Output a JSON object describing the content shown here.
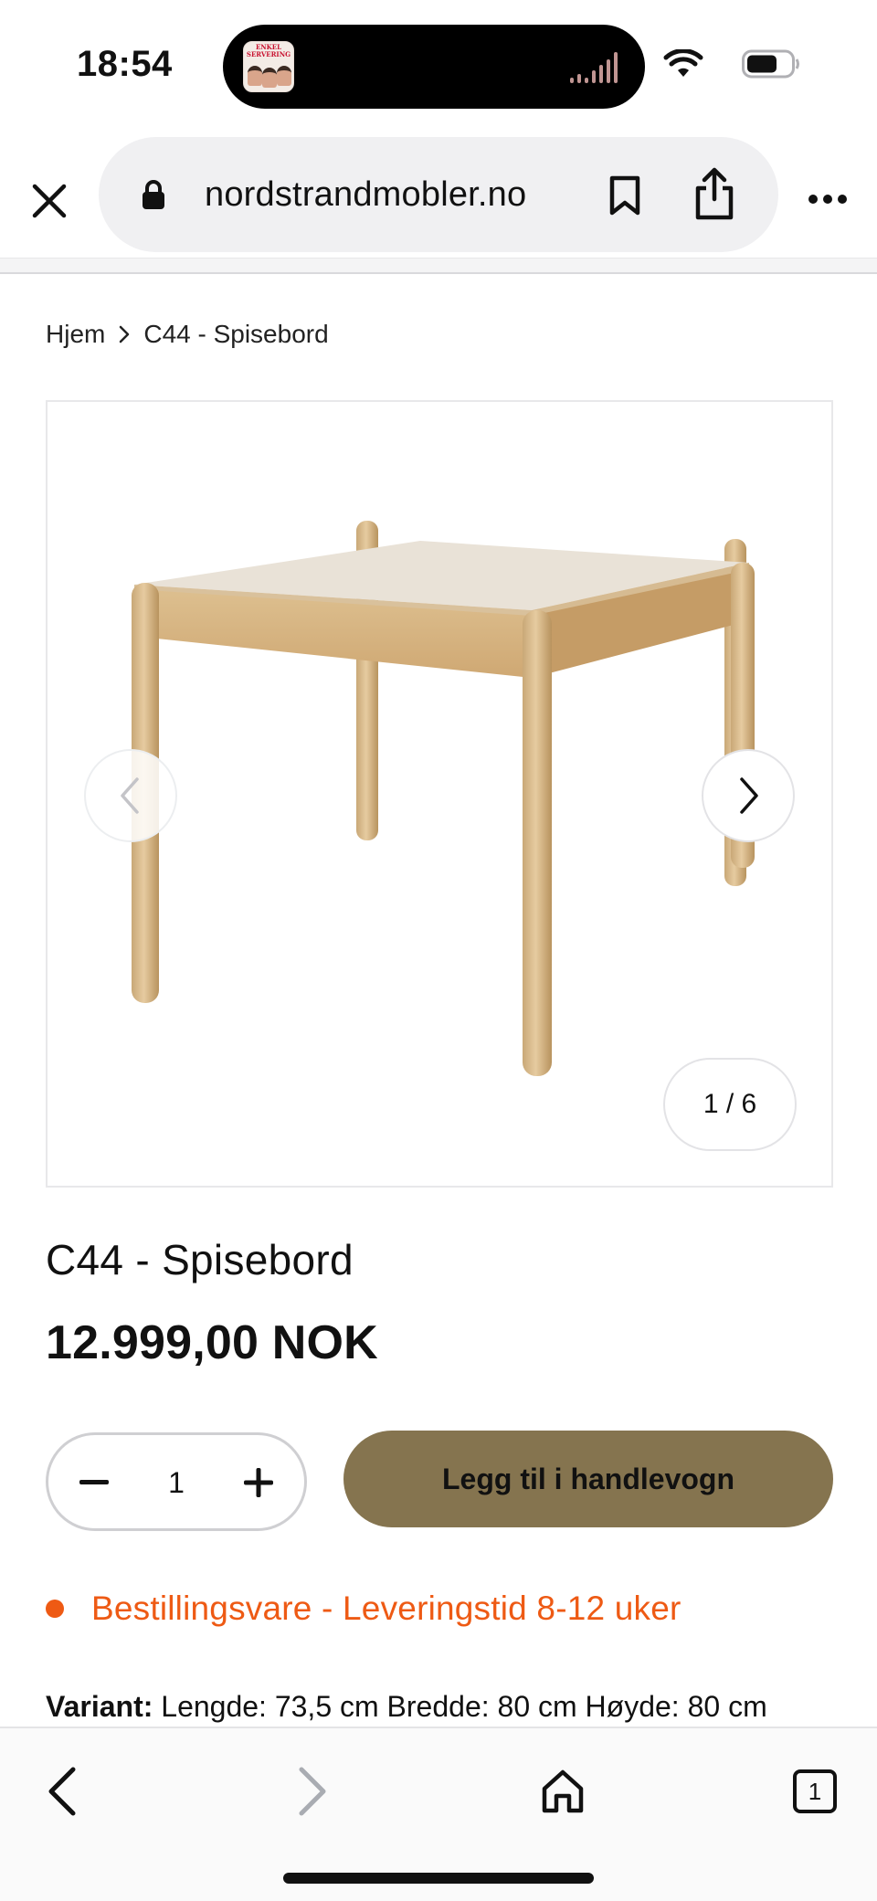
{
  "status_bar": {
    "time": "18:54",
    "now_playing_art_caption": "ENKEL SERVERING"
  },
  "browser": {
    "url": "nordstrandmobler.no",
    "icons": {
      "close": "close-icon",
      "lock": "lock-icon",
      "bookmark": "bookmark-icon",
      "share": "share-icon",
      "more": "more-icon"
    }
  },
  "breadcrumb": {
    "home": "Hjem",
    "current": "C44 - Spisebord"
  },
  "gallery": {
    "counter": "1 / 6",
    "current_index": 1,
    "total": 6
  },
  "product": {
    "title": "C44 - Spisebord",
    "price": "12.999,00 NOK"
  },
  "cart": {
    "quantity": "1",
    "add_label": "Legg til i handlevogn",
    "accent_color": "#85744f"
  },
  "stock": {
    "text": "Bestillingsvare - Leveringstid 8-12 uker",
    "color": "#ee5a14"
  },
  "variant": {
    "label": "Variant:",
    "value": "Lengde: 73,5 cm Bredde: 80 cm Høyde: 80 cm"
  },
  "toolbar": {
    "tab_count": "1"
  }
}
